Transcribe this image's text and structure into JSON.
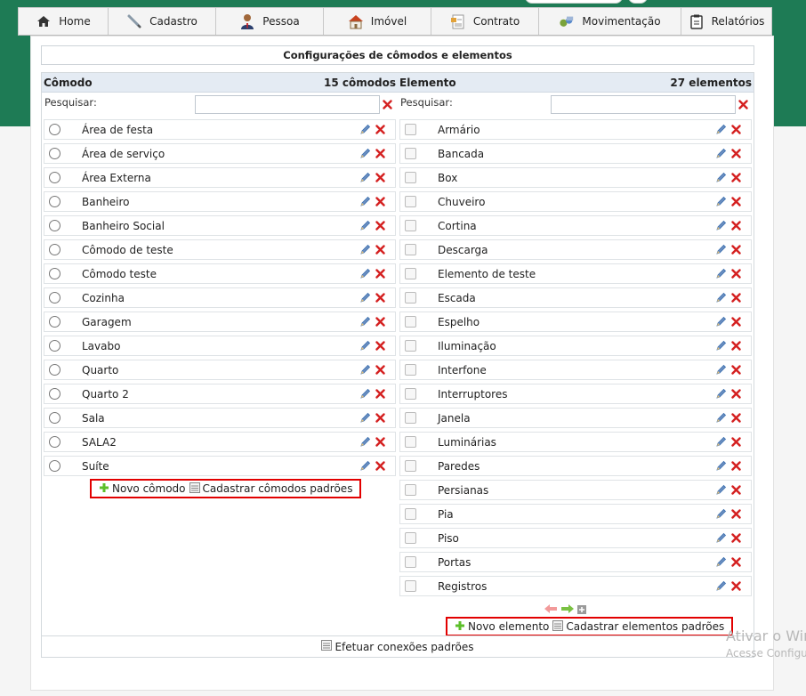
{
  "nav": {
    "items": [
      {
        "label": "Home",
        "icon": "home-icon"
      },
      {
        "label": "Cadastro",
        "icon": "pencil-icon"
      },
      {
        "label": "Pessoa",
        "icon": "person-icon"
      },
      {
        "label": "Imóvel",
        "icon": "house-icon"
      },
      {
        "label": "Contrato",
        "icon": "contract-icon"
      },
      {
        "label": "Movimentação",
        "icon": "movement-icon"
      },
      {
        "label": "Relatórios",
        "icon": "report-icon"
      }
    ]
  },
  "page": {
    "title": "Configurações de cômodos e elementos"
  },
  "comodo": {
    "header": "Cômodo",
    "count": "15 cômodos",
    "search_label": "Pesquisar:",
    "search_value": "",
    "items": [
      "Área de festa",
      "Área de serviço",
      "Área Externa",
      "Banheiro",
      "Banheiro Social",
      "Cômodo de teste",
      "Cômodo teste",
      "Cozinha",
      "Garagem",
      "Lavabo",
      "Quarto",
      "Quarto 2",
      "Sala",
      "SALA2",
      "Suíte"
    ],
    "new_label": "Novo cômodo",
    "defaults_label": "Cadastrar cômodos padrões"
  },
  "elemento": {
    "header": "Elemento",
    "count": "27 elementos",
    "search_label": "Pesquisar:",
    "search_value": "",
    "items": [
      "Armário",
      "Bancada",
      "Box",
      "Chuveiro",
      "Cortina",
      "Descarga",
      "Elemento de teste",
      "Escada",
      "Espelho",
      "Iluminação",
      "Interfone",
      "Interruptores",
      "Janela",
      "Luminárias",
      "Paredes",
      "Persianas",
      "Pia",
      "Piso",
      "Portas",
      "Registros"
    ],
    "new_label": "Novo elemento",
    "defaults_label": "Cadastrar elementos padrões"
  },
  "footer": {
    "connections_label": "Efetuar conexões padrões"
  },
  "watermark": {
    "line1": "Ativar o Windows",
    "line2": "Acesse Configurações"
  },
  "colors": {
    "brand_green": "#1e7b55",
    "delete_red": "#d42020",
    "edit_blue": "#3a6fb0",
    "highlight_red": "#e20000",
    "add_green": "#5cbf2a"
  }
}
